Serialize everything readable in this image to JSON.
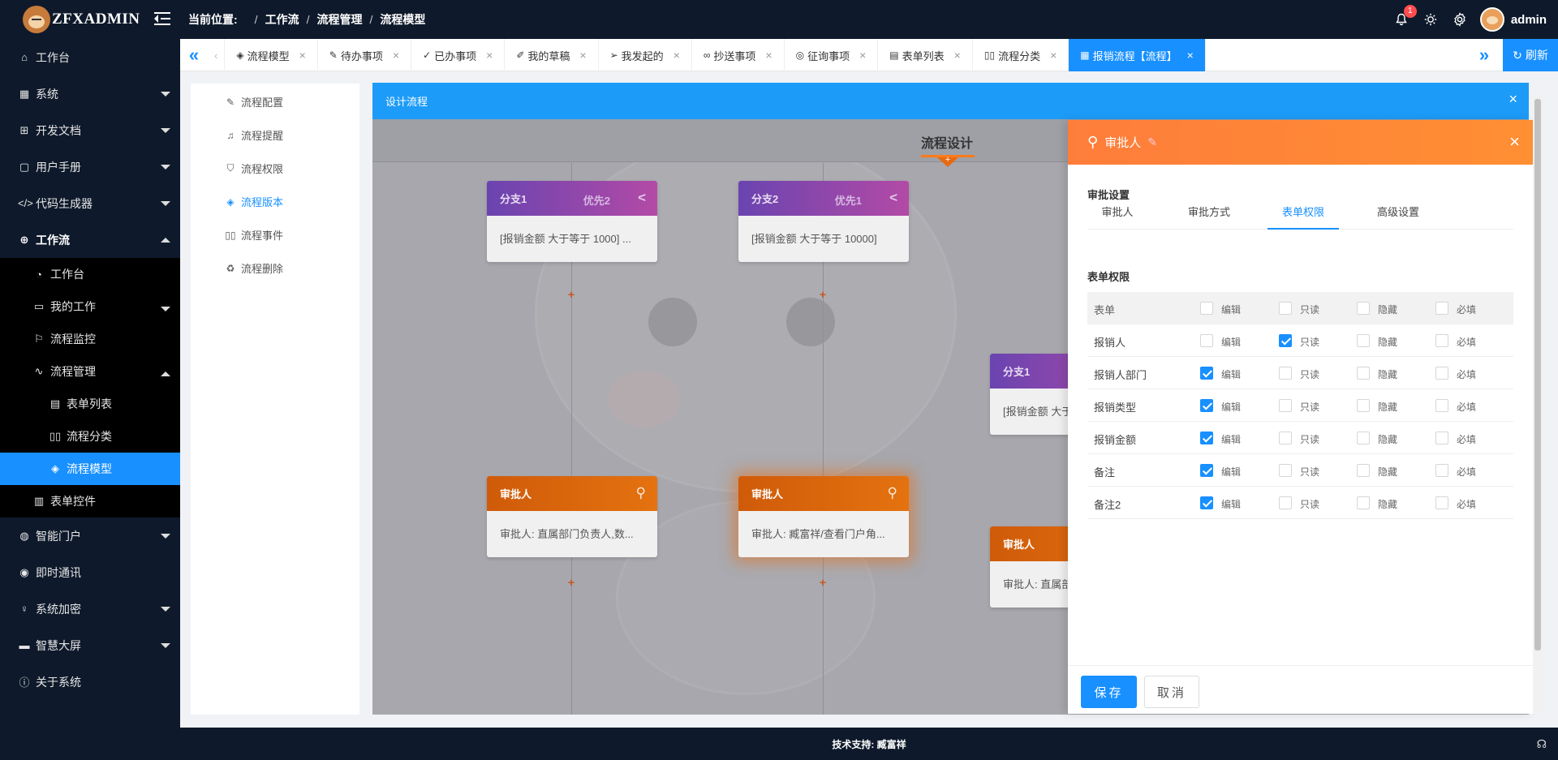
{
  "app": {
    "logo_text": "ZFXADMIN"
  },
  "header": {
    "breadcrumb_label": "当前位置:",
    "breadcrumb": [
      "工作流",
      "流程管理",
      "流程模型"
    ],
    "notification_count": "1",
    "user_name": "admin"
  },
  "sidebar": {
    "items": [
      {
        "label": "工作台"
      },
      {
        "label": "系统"
      },
      {
        "label": "开发文档"
      },
      {
        "label": "用户手册"
      },
      {
        "label": "代码生成器"
      },
      {
        "label": "工作流"
      },
      {
        "label": "工作台"
      },
      {
        "label": "我的工作"
      },
      {
        "label": "流程监控"
      },
      {
        "label": "流程管理"
      },
      {
        "label": "表单列表"
      },
      {
        "label": "流程分类"
      },
      {
        "label": "流程模型"
      },
      {
        "label": "表单控件"
      },
      {
        "label": "智能门户"
      },
      {
        "label": "即时通讯"
      },
      {
        "label": "系统加密"
      },
      {
        "label": "智慧大屏"
      },
      {
        "label": "关于系统"
      }
    ]
  },
  "tabs": {
    "items": [
      {
        "label": "流程模型"
      },
      {
        "label": "待办事项"
      },
      {
        "label": "已办事项"
      },
      {
        "label": "我的草稿"
      },
      {
        "label": "我发起的"
      },
      {
        "label": "抄送事项"
      },
      {
        "label": "征询事项"
      },
      {
        "label": "表单列表"
      },
      {
        "label": "流程分类"
      },
      {
        "label": "报销流程【流程】"
      }
    ],
    "refresh_label": "刷新"
  },
  "left_menu": {
    "items": [
      {
        "label": "流程配置"
      },
      {
        "label": "流程提醒"
      },
      {
        "label": "流程权限"
      },
      {
        "label": "流程版本"
      },
      {
        "label": "流程事件"
      },
      {
        "label": "流程删除"
      }
    ]
  },
  "designer": {
    "title": "设计流程",
    "canvas_title": "流程设计",
    "nodes": [
      {
        "title": "分支1",
        "priority": "优先2",
        "body": "[报销金额 大于等于 1000] ..."
      },
      {
        "title": "分支2",
        "priority": "优先1",
        "body": "[报销金额 大于等于 10000]"
      },
      {
        "title": "分支1",
        "priority": "",
        "body": "[报销金额 大于"
      },
      {
        "title": "审批人",
        "priority": "",
        "body": "审批人: 直属部门负责人,数..."
      },
      {
        "title": "审批人",
        "priority": "",
        "body": "审批人: 臧富祥/查看门户角..."
      },
      {
        "title": "审批人",
        "priority": "",
        "body": "审批人: 直属部"
      }
    ]
  },
  "drawer": {
    "title": "审批人",
    "section_settings": "审批设置",
    "tabs": [
      "审批人",
      "审批方式",
      "表单权限",
      "高级设置"
    ],
    "active_tab": "表单权限",
    "section_permissions": "表单权限",
    "column_labels": [
      "编辑",
      "只读",
      "隐藏",
      "必填"
    ],
    "header_row": "表单",
    "rows": [
      {
        "name": "报销人",
        "edit": false,
        "readonly": true,
        "hidden": false,
        "required": false
      },
      {
        "name": "报销人部门",
        "edit": true,
        "readonly": false,
        "hidden": false,
        "required": false
      },
      {
        "name": "报销类型",
        "edit": true,
        "readonly": false,
        "hidden": false,
        "required": false
      },
      {
        "name": "报销金额",
        "edit": true,
        "readonly": false,
        "hidden": false,
        "required": false
      },
      {
        "name": "备注",
        "edit": true,
        "readonly": false,
        "hidden": false,
        "required": false
      },
      {
        "name": "备注2",
        "edit": true,
        "readonly": false,
        "hidden": false,
        "required": false
      }
    ],
    "save_label": "保存",
    "cancel_label": "取消"
  },
  "footer": {
    "text": "技术支持: 臧富祥"
  },
  "colors": {
    "primary": "#1890ff",
    "sidebar_bg": "#0e1a2b",
    "drawer_header": "#ff8a35",
    "branch_header": "#8a46ad",
    "approver_header": "#dd6a0d"
  }
}
